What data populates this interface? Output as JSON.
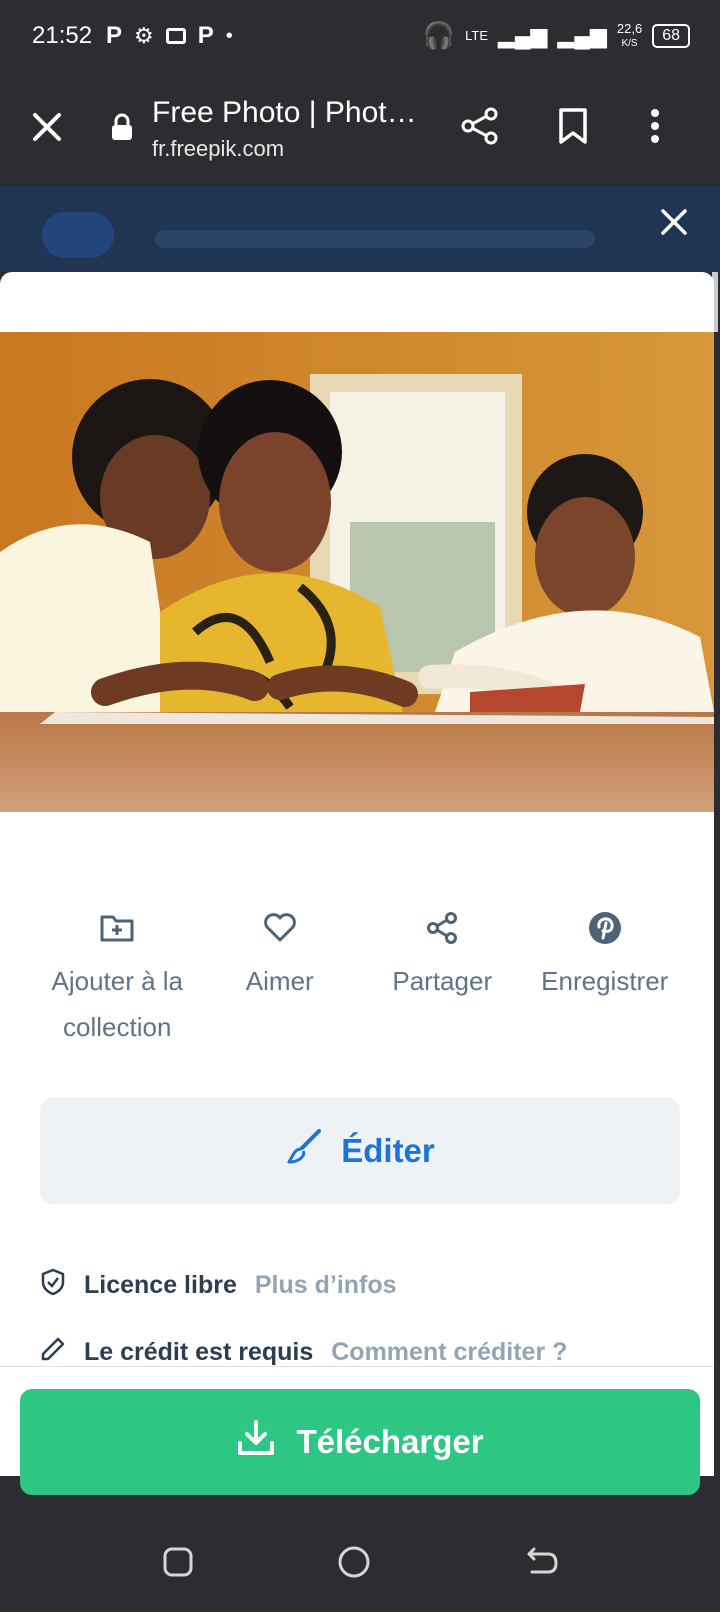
{
  "status_bar": {
    "time": "21:52",
    "network": "LTE",
    "speed": "22,6",
    "speed_unit": "K/S",
    "battery": "68"
  },
  "browser": {
    "title": "Free Photo | Phot…",
    "url": "fr.freepik.com"
  },
  "actions": [
    {
      "label": "Ajouter à la collection",
      "icon": "folder-add-icon"
    },
    {
      "label": "Aimer",
      "icon": "heart-icon"
    },
    {
      "label": "Partager",
      "icon": "share-icon"
    },
    {
      "label": "Enregistrer",
      "icon": "pinterest-icon"
    }
  ],
  "edit_button": {
    "label": "Éditer"
  },
  "license": {
    "label": "Licence libre",
    "more": "Plus d’infos"
  },
  "credit": {
    "text": "Le crédit est requis",
    "link": "Comment créditer ?"
  },
  "download_button": {
    "label": "Télécharger"
  },
  "colors": {
    "accent_blue": "#1d74d8",
    "download_green": "#2ec685",
    "dark_bar": "#2b2d31"
  }
}
